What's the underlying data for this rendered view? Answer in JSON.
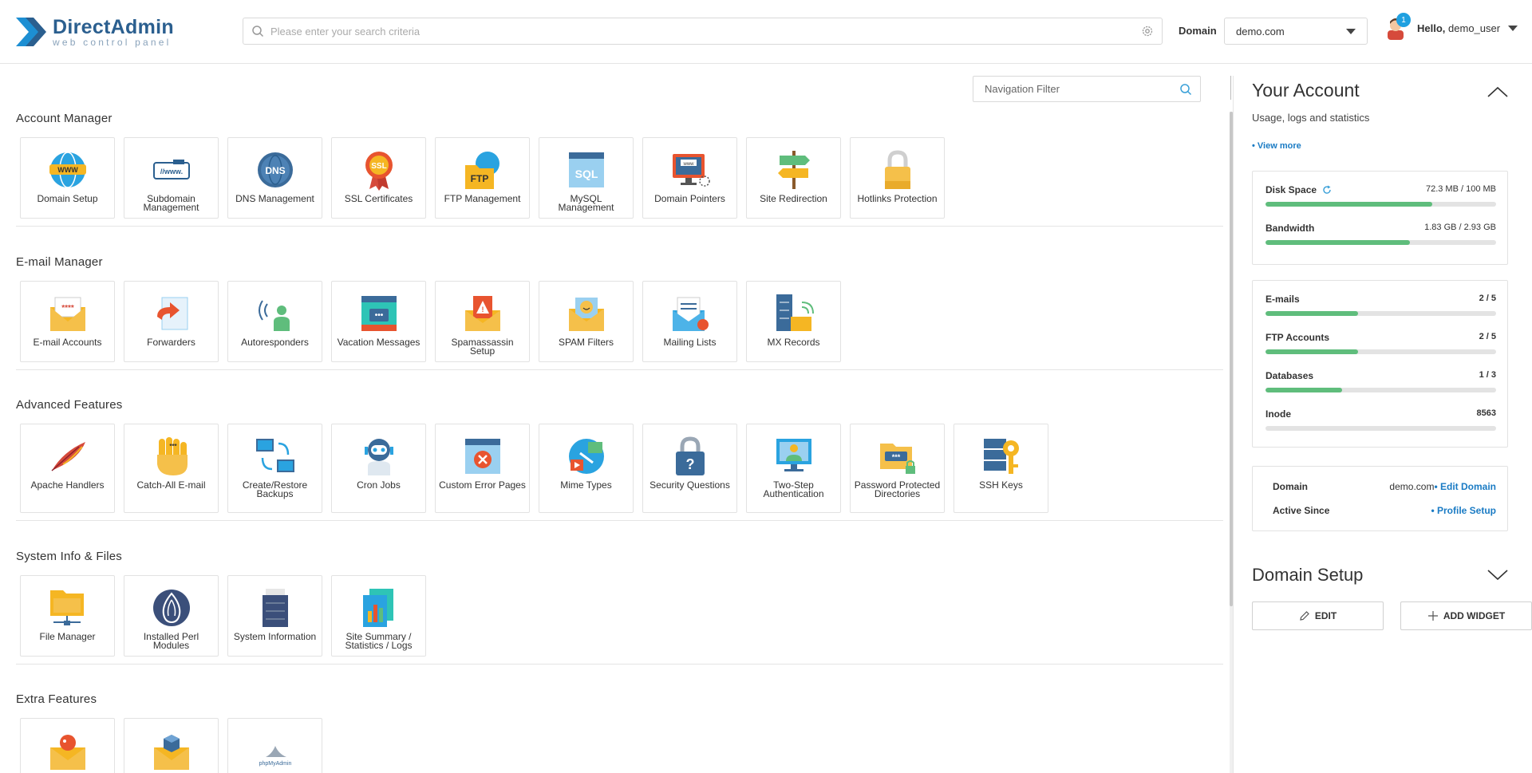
{
  "header": {
    "logo_name": "DirectAdmin",
    "logo_sub": "web control panel",
    "search_placeholder": "Please enter your search criteria",
    "domain_label": "Domain",
    "domain_value": "demo.com",
    "notification_count": "1",
    "hello_prefix": "Hello,",
    "username": "demo_user"
  },
  "main": {
    "nav_filter_placeholder": "Navigation Filter",
    "sections": [
      {
        "title": "Account Manager",
        "items": [
          {
            "label": "Domain Setup",
            "icon": "globe-www-icon"
          },
          {
            "label": "Subdomain Management",
            "icon": "subdomain-icon"
          },
          {
            "label": "DNS Management",
            "icon": "dns-globe-icon"
          },
          {
            "label": "SSL Certificates",
            "icon": "ssl-badge-icon"
          },
          {
            "label": "FTP Management",
            "icon": "ftp-folder-icon"
          },
          {
            "label": "MySQL Management",
            "icon": "sql-window-icon"
          },
          {
            "label": "Domain Pointers",
            "icon": "monitor-www-icon"
          },
          {
            "label": "Site Redirection",
            "icon": "signpost-icon"
          },
          {
            "label": "Hotlinks Protection",
            "icon": "padlock-icon"
          }
        ]
      },
      {
        "title": "E-mail Manager",
        "items": [
          {
            "label": "E-mail Accounts",
            "icon": "envelope-password-icon"
          },
          {
            "label": "Forwarders",
            "icon": "forward-document-icon"
          },
          {
            "label": "Autoresponders",
            "icon": "autoresponder-person-icon"
          },
          {
            "label": "Vacation Messages",
            "icon": "vacation-window-icon"
          },
          {
            "label": "Spamassassin Setup",
            "icon": "spam-warning-envelope-icon"
          },
          {
            "label": "SPAM Filters",
            "icon": "smiley-envelope-icon"
          },
          {
            "label": "Mailing Lists",
            "icon": "mailing-list-icon"
          },
          {
            "label": "MX Records",
            "icon": "server-envelope-icon"
          }
        ]
      },
      {
        "title": "Advanced Features",
        "items": [
          {
            "label": "Apache Handlers",
            "icon": "feather-icon"
          },
          {
            "label": "Catch-All E-mail",
            "icon": "hand-icon"
          },
          {
            "label": "Create/Restore Backups",
            "icon": "backup-monitors-icon"
          },
          {
            "label": "Cron Jobs",
            "icon": "robot-icon"
          },
          {
            "label": "Custom Error Pages",
            "icon": "error-window-icon"
          },
          {
            "label": "Mime Types",
            "icon": "media-globe-icon"
          },
          {
            "label": "Security Questions",
            "icon": "question-lock-icon"
          },
          {
            "label": "Two-Step Authentication",
            "icon": "two-step-monitor-icon"
          },
          {
            "label": "Password Protected Directories",
            "icon": "password-folder-icon"
          },
          {
            "label": "SSH Keys",
            "icon": "server-key-icon"
          }
        ]
      },
      {
        "title": "System Info & Files",
        "items": [
          {
            "label": "File Manager",
            "icon": "folder-network-icon"
          },
          {
            "label": "Installed Perl Modules",
            "icon": "perl-onion-icon"
          },
          {
            "label": "System Information",
            "icon": "server-info-icon"
          },
          {
            "label": "Site Summary / Statistics / Logs",
            "icon": "statistics-chart-icon"
          }
        ]
      },
      {
        "title": "Extra Features",
        "items": [
          {
            "label": "",
            "icon": "squirrel-envelope-icon"
          },
          {
            "label": "",
            "icon": "cube-envelope-icon"
          },
          {
            "label": "",
            "icon": "phpmyadmin-icon",
            "logo_text": "phpMyAdmin"
          }
        ]
      }
    ]
  },
  "account": {
    "title": "Your Account",
    "subtitle": "Usage, logs and statistics",
    "view_more": "• View more",
    "disk": {
      "label": "Disk Space",
      "value": "72.3 MB / 100 MB",
      "fraction": 0.723
    },
    "bandwidth": {
      "label": "Bandwidth",
      "value": "1.83 GB / 2.93 GB",
      "fraction": 0.625
    },
    "emails": {
      "label": "E-mails",
      "value": "2 / 5",
      "fraction": 0.4
    },
    "ftp": {
      "label": "FTP Accounts",
      "value": "2 / 5",
      "fraction": 0.4
    },
    "databases": {
      "label": "Databases",
      "value": "1 / 3",
      "fraction": 0.333
    },
    "inode": {
      "label": "Inode",
      "value": "8563",
      "fraction": 0
    },
    "domain_label": "Domain",
    "domain_value": "demo.com",
    "edit_domain": "• Edit Domain",
    "active_since_label": "Active Since",
    "profile_setup": "• Profile Setup"
  },
  "domain_setup_widget": {
    "title": "Domain Setup",
    "edit_label": "EDIT",
    "add_widget_label": "ADD WIDGET"
  },
  "colors": {
    "brand": "#2b5f8f",
    "accent": "#1a7bc4",
    "progress": "#5fbd7c",
    "badge": "#1fa0e0"
  }
}
